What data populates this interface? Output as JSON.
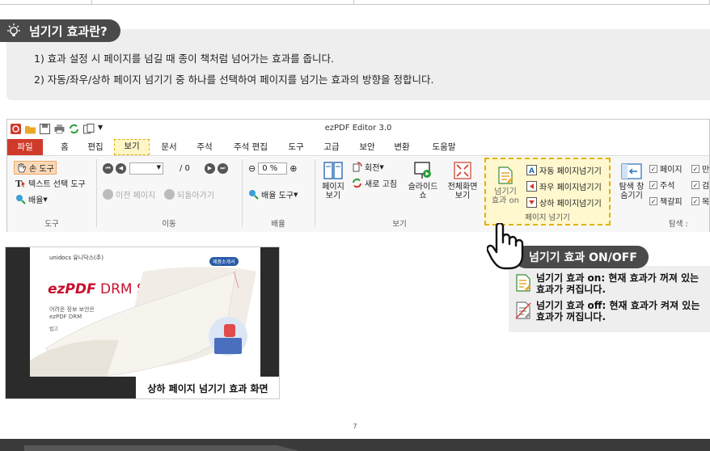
{
  "section": {
    "title": "넘기기 효과란?",
    "lines": [
      "1)  효과 설정 시 페이지를 넘길 때 종이 책처럼 넘어가는 효과를 줍니다.",
      "2)  자동/좌우/상하 페이지 넘기기 중 하나를 선택하여 페이지를 넘기는 효과의 방향을 정합니다."
    ]
  },
  "app": {
    "title": "ezPDF Editor 3.0",
    "tabs": [
      "파일",
      "홈",
      "편집",
      "보기",
      "문서",
      "주석",
      "주석 편집",
      "도구",
      "고급",
      "보안",
      "변환",
      "도움말"
    ],
    "active_tab": "보기",
    "tools_group": {
      "label": "도구",
      "hand": "손 도구",
      "text_select": "텍스트 선택 도구",
      "zoom": "배율"
    },
    "move_group": {
      "label": "이동",
      "page_total": "/ 0",
      "prev_page": "이전 페이지",
      "go_back": "되돌아가기"
    },
    "zoom_group": {
      "label": "배율",
      "zoom_value": "0 %",
      "zoom_tool": "배율 도구"
    },
    "view_group": {
      "label": "보기",
      "page_view": "페이지\n보기",
      "rotate": "회전",
      "refresh": "새로 고침",
      "slideshow": "슬라이드\n쇼",
      "fullscreen": "전체화면\n보기"
    },
    "flip_group": {
      "label": "페이지 넘기기",
      "flip_on": "넘기기\n효과 on",
      "auto": "자동 페이지넘기기",
      "lr": "좌우 페이지넘기기",
      "ud": "상하 페이지넘기기"
    },
    "nav_group": {
      "nav_window": "탐색 창\n숨기기",
      "checks": [
        "페이지",
        "주석",
        "책갈피"
      ],
      "checks2": [
        "만",
        "검",
        "목"
      ],
      "label_partial": "탐색 :"
    }
  },
  "callout": {
    "title": "넘기기 효과 ON/OFF",
    "on_line1": "넘기기 효과 on: 현재 효과가 꺼져 있는",
    "on_line2": "효과가 켜집니다.",
    "off_line1": "넘기기 효과 off: 현재 효과가 켜져 있는",
    "off_line2": "효과가 꺼집니다."
  },
  "screenshot": {
    "brand_small": "unidocs 유니닥스(주)",
    "brand_big_1": "ezPDF",
    "brand_big_2": " DRM Servi",
    "sub1": "어려운 정보 보안은",
    "sub2": "ezPDF DRM",
    "sub3": "법고",
    "badge": "제품소개서",
    "caption": "상하 페이지 넘기기 효과 화면"
  },
  "page_number": "7",
  "colors": {
    "header_bg": "#4a4a4a",
    "file_tab": "#d03a2a",
    "highlight": "#e2b100"
  }
}
